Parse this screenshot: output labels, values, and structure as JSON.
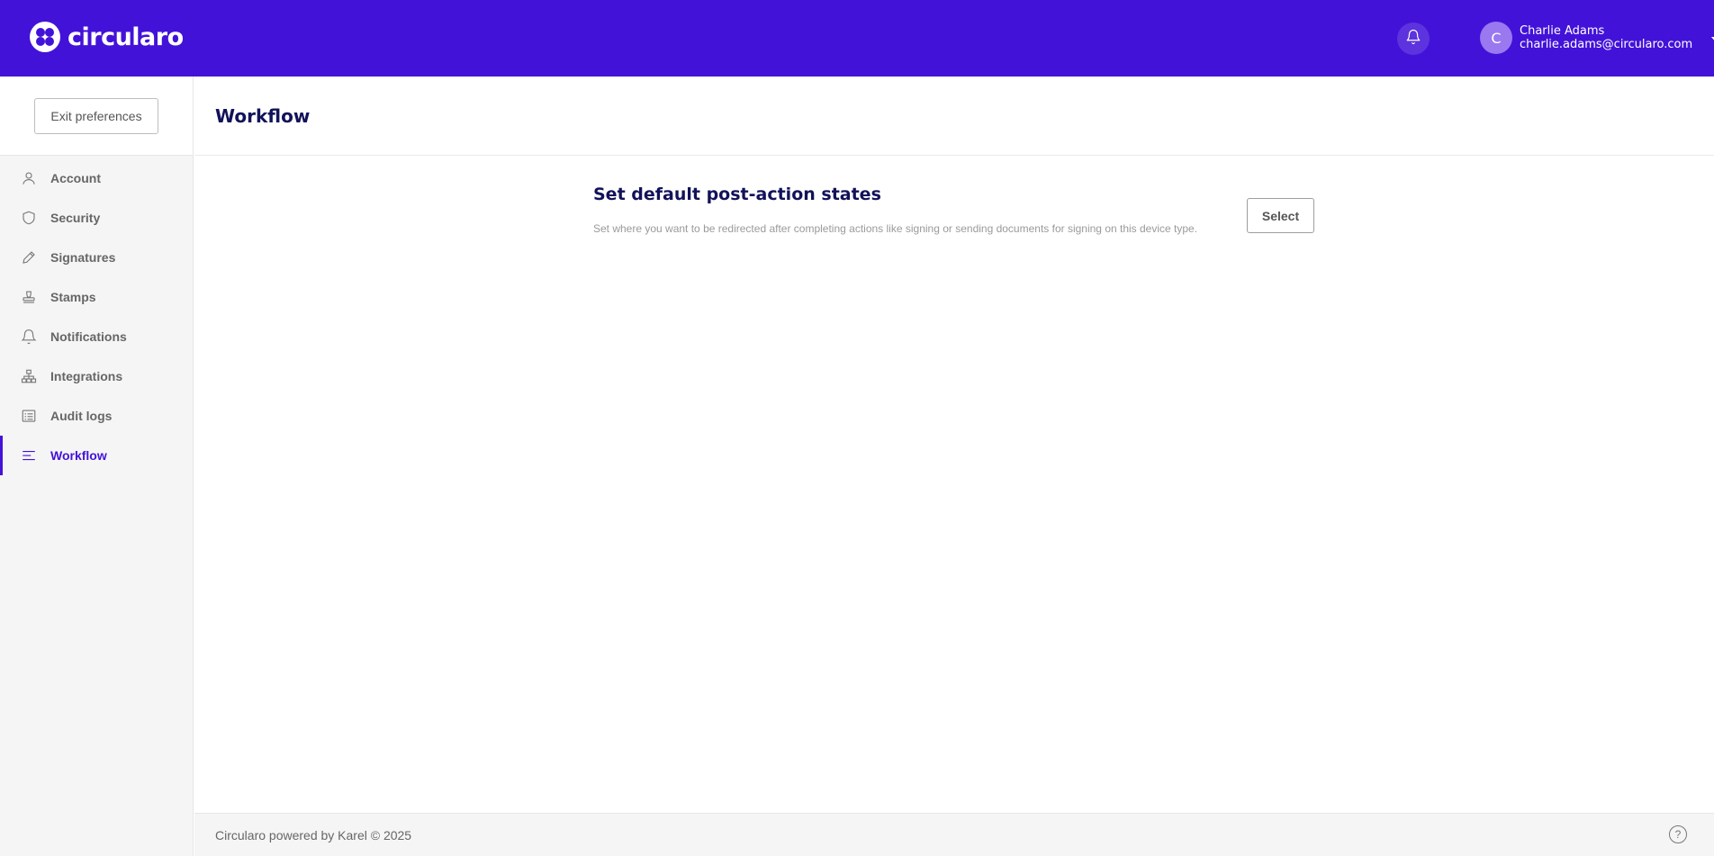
{
  "app": {
    "brand": "circularo"
  },
  "header": {
    "user_initial": "C",
    "user_name": "Charlie Adams",
    "user_email": "charlie.adams@circularo.com",
    "icons": {
      "notifications": "bell-icon",
      "menu": "caret-down-icon"
    }
  },
  "sidebar": {
    "exit_label": "Exit preferences",
    "items": [
      {
        "label": "Account",
        "icon": "user-icon"
      },
      {
        "label": "Security",
        "icon": "shield-icon"
      },
      {
        "label": "Signatures",
        "icon": "pen-icon"
      },
      {
        "label": "Stamps",
        "icon": "stamp-icon"
      },
      {
        "label": "Notifications",
        "icon": "bell-icon"
      },
      {
        "label": "Integrations",
        "icon": "sitemap-icon"
      },
      {
        "label": "Audit logs",
        "icon": "list-icon"
      },
      {
        "label": "Workflow",
        "icon": "lines-icon",
        "active": true
      }
    ]
  },
  "main": {
    "title": "Workflow",
    "section": {
      "title": "Set default post-action states",
      "description": "Set where you want to be redirected after completing actions like signing or sending documents for signing on this device type.",
      "button_label": "Select"
    }
  },
  "footer": {
    "text": "Circularo powered by Karel © 2025",
    "help_glyph": "?"
  },
  "colors": {
    "primary": "#4312d9",
    "title": "#12125a",
    "sidebar_bg": "#f5f5f5"
  }
}
